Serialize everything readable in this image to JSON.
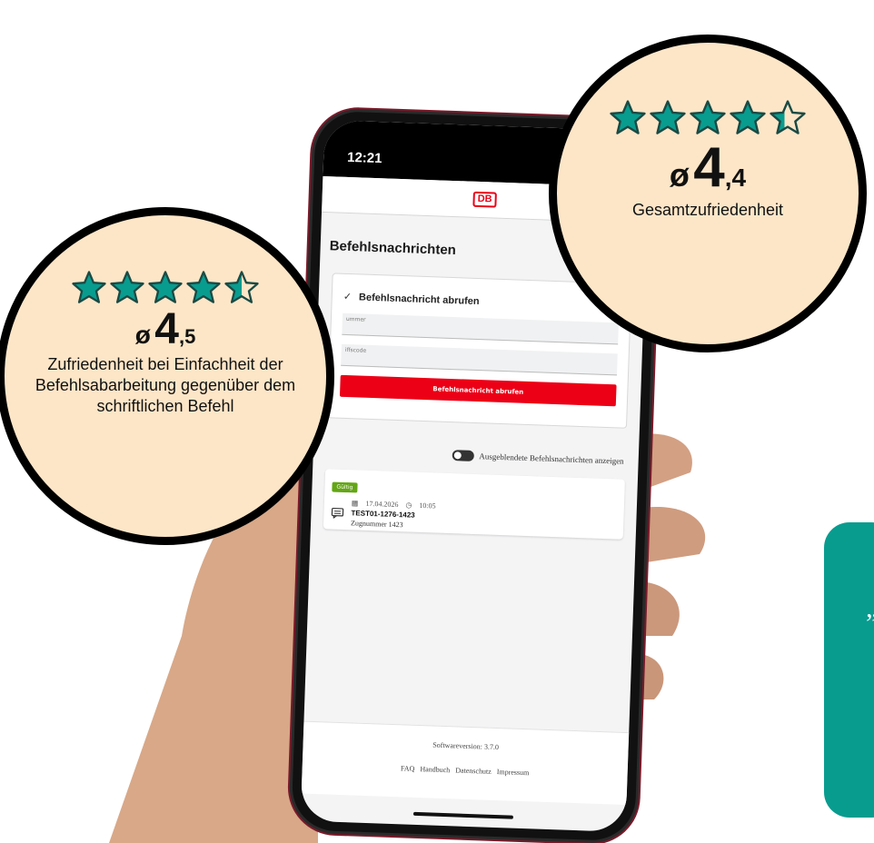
{
  "phone": {
    "time": "12:21",
    "logo": "DB",
    "page_title": "Befehlsnachrichten",
    "form": {
      "heading": "Befehlsnachricht abrufen",
      "field1_label": "ummer",
      "field2_label": "iffscode",
      "button_label": "Befehlsnachricht abrufen"
    },
    "toggle_label": "Ausgeblendete Befehlsnachrichten anzeigen",
    "message": {
      "status": "Gültig",
      "date": "17.04.2026",
      "time": "10:05",
      "id": "TEST01-1276-1423",
      "train": "Zugnummer 1423"
    },
    "footer": {
      "version": "Softwareversion: 3.7.0",
      "links": [
        "FAQ",
        "Handbuch",
        "Datenschutz",
        "Impressum"
      ]
    }
  },
  "ratings": {
    "left": {
      "stars": 4.5,
      "avg_symbol": "ø",
      "avg_int": "4",
      "avg_dec": ",5",
      "caption": "Zufriedenheit bei Einfachheit der Befehlsabarbeitung gegenüber dem schriftlichen Befehl"
    },
    "right": {
      "stars": 4.4,
      "avg_symbol": "ø",
      "avg_int": "4",
      "avg_dec": ",4",
      "caption": "Gesamtzufriedenheit"
    }
  },
  "quote": {
    "mark": "„"
  },
  "colors": {
    "db_red": "#ec0016",
    "teal": "#089c8f",
    "circle_fill": "#fde6c8",
    "badge_green": "#63a615"
  }
}
